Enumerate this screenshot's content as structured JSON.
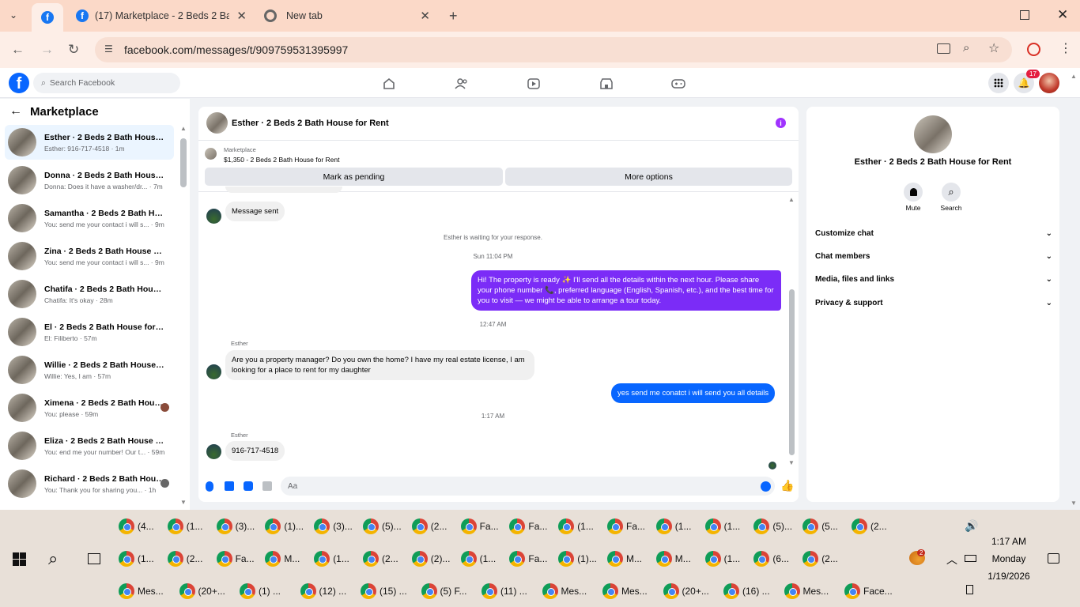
{
  "browser": {
    "tabs": [
      {
        "title": "",
        "active": true
      },
      {
        "title": "(17) Marketplace - 2 Beds 2 Bat"
      },
      {
        "title": "New tab"
      }
    ],
    "url": "facebook.com/messages/t/909759531395997"
  },
  "facebook": {
    "search_placeholder": "Search Facebook",
    "notification_count": "17"
  },
  "sidebar": {
    "title": "Marketplace",
    "conversations": [
      {
        "name": "Esther · 2 Beds 2 Bath House fo...",
        "preview": "Esther: 916-717-4518 · 1m",
        "selected": true
      },
      {
        "name": "Donna · 2 Beds 2 Bath House f...",
        "preview": "Donna: Does it have a washer/dr... · 7m"
      },
      {
        "name": "Samantha · 2 Beds 2 Bath Hous...",
        "preview": "You: send me your contact i will s... · 9m"
      },
      {
        "name": "Zina · 2 Beds 2 Bath House for ...",
        "preview": "You: send me your contact i will s... · 9m"
      },
      {
        "name": "Chatifa · 2 Beds 2 Bath House f...",
        "preview": "Chatifa: It's okay · 28m"
      },
      {
        "name": "El · 2 Beds 2 Bath House for Rent",
        "preview": "El: Filiberto · 57m"
      },
      {
        "name": "Willie · 2 Beds 2 Bath House fo...",
        "preview": "Willie: Yes, I am · 57m"
      },
      {
        "name": "Ximena · 2 Beds 2 Bath Hous...",
        "preview": "You: please · 59m"
      },
      {
        "name": "Eliza · 2 Beds 2 Bath House for ...",
        "preview": "You: end me your number! Our t... · 59m"
      },
      {
        "name": "Richard · 2 Beds 2 Bath Hous...",
        "preview": "You: Thank you for sharing you... · 1h"
      }
    ]
  },
  "chat": {
    "header_title": "Esther · 2 Beds 2 Bath House for Rent",
    "listing_source": "Marketplace",
    "listing_title": "$1,350 - 2 Beds 2 Bath House for Rent",
    "mark_pending": "Mark as pending",
    "more_options": "More options",
    "msg_sent": "Message sent",
    "waiting": "Esther is waiting for your response.",
    "time1": "Sun 11:04 PM",
    "out1": "Hi! The property is ready ✨ I'll send all the details within the next hour. Please share your phone number 📞, preferred language (English, Spanish, etc.), and the best time for you to visit — we might be able to arrange a tour today.",
    "time2": "12:47 AM",
    "sender": "Esther",
    "in1": "Are you a property manager? Do you own the home? I have my real estate license, I am looking for a place to rent for my daughter",
    "out2": "yes send me conatct i will send you all details",
    "time3": "1:17 AM",
    "in2": "916-717-4518",
    "composer_placeholder": "Aa"
  },
  "info": {
    "title": "Esther · 2 Beds 2 Bath House for Rent",
    "mute": "Mute",
    "search": "Search",
    "menu": [
      "Customize chat",
      "Chat members",
      "Media, files and links",
      "Privacy & support"
    ]
  },
  "taskbar": {
    "row1": [
      "(4...",
      "(1...",
      "(3)...",
      "(1)...",
      "(3)...",
      "(5)...",
      "(2...",
      "Fa...",
      "Fa...",
      "(1...",
      "Fa...",
      "(1...",
      "(1...",
      "(5)...",
      "(5...",
      "(2..."
    ],
    "row2": [
      "(1...",
      "(2...",
      "Fa...",
      "M...",
      "(1...",
      "(2...",
      "(2)...",
      "(1...",
      "Fa...",
      "(1)...",
      "M...",
      "M...",
      "(1...",
      "(6...",
      "(2..."
    ],
    "row3": [
      "Mes...",
      "(20+...",
      "(1) ...",
      "(12) ...",
      "(15) ...",
      "(5) F...",
      "(11) ...",
      "Mes...",
      "Mes...",
      "(20+...",
      "(16) ...",
      "Mes...",
      "Face..."
    ],
    "weather_badge": "2",
    "time": "1:17 AM",
    "day": "Monday",
    "date": "1/19/2026"
  }
}
